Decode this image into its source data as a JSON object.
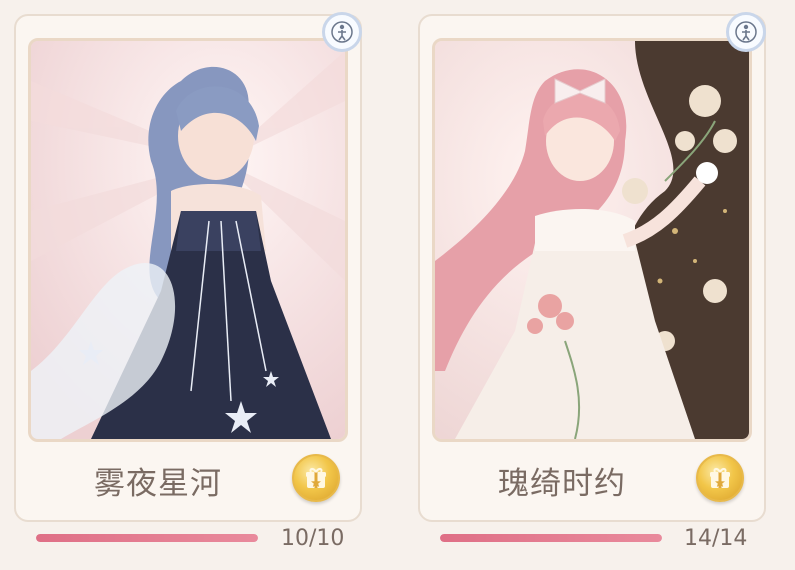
{
  "cards": [
    {
      "name": "雾夜星河",
      "progress_text": "10/10",
      "progress_fraction": 1.0,
      "badge_icon": "person-silhouette-icon",
      "action_icon": "gift-box-icon",
      "colors": {
        "dress": "#2b3048",
        "hair": "#8a9bc2",
        "background": "#f4e3e1"
      }
    },
    {
      "name": "瑰绮时约",
      "progress_text": "14/14",
      "progress_fraction": 1.0,
      "badge_icon": "person-silhouette-icon",
      "action_icon": "gift-box-icon",
      "colors": {
        "dress": "#f6eee8",
        "hair": "#e8a2a8",
        "background": "#f4e3e1"
      }
    }
  ],
  "colors": {
    "progress_fill": "#e37a90",
    "text": "#7a6b63",
    "gold": "#f2c649"
  }
}
